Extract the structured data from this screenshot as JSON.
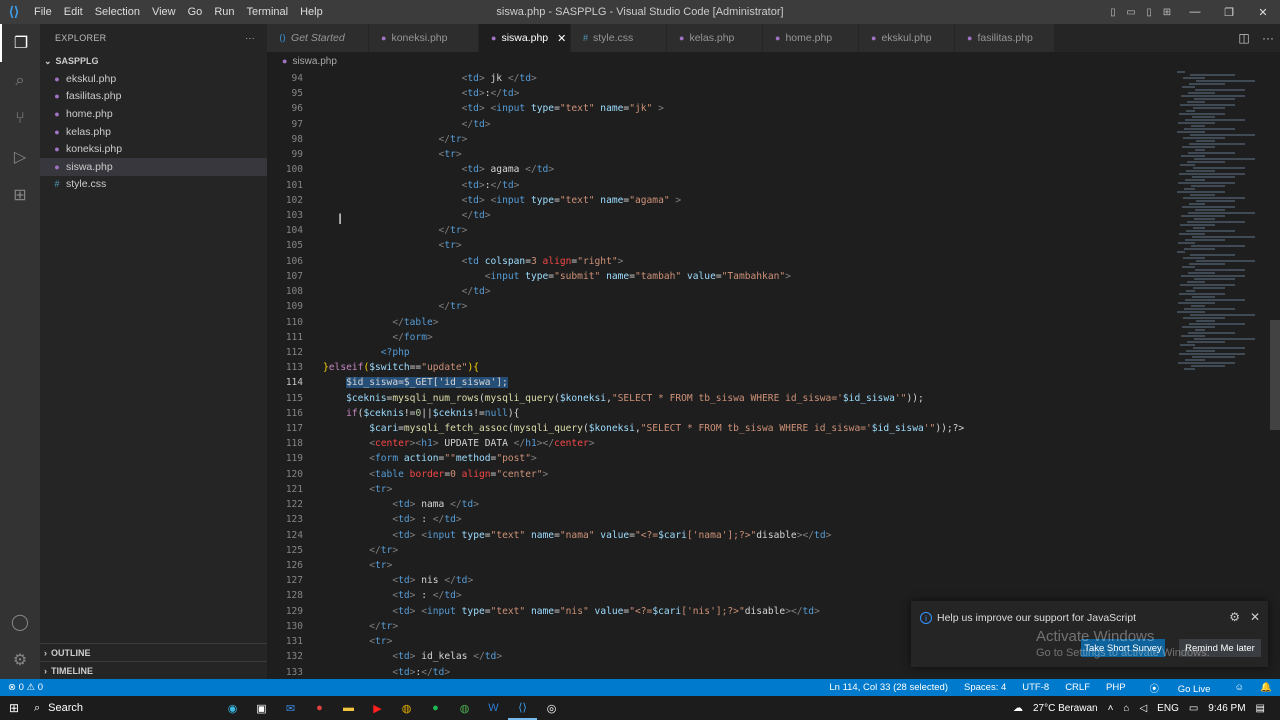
{
  "window": {
    "title": "siswa.php - SASPPLG - Visual Studio Code [Administrator]",
    "menu": [
      "File",
      "Edit",
      "Selection",
      "View",
      "Go",
      "Run",
      "Terminal",
      "Help"
    ]
  },
  "sidebar": {
    "header": "EXPLORER",
    "folder": "SASPPLG",
    "files": [
      {
        "name": "ekskul.php",
        "type": "php"
      },
      {
        "name": "fasilitas.php",
        "type": "php"
      },
      {
        "name": "home.php",
        "type": "php"
      },
      {
        "name": "kelas.php",
        "type": "php"
      },
      {
        "name": "koneksi.php",
        "type": "php"
      },
      {
        "name": "siswa.php",
        "type": "php"
      },
      {
        "name": "style.css",
        "type": "css"
      }
    ],
    "outline": "OUTLINE",
    "timeline": "TIMELINE"
  },
  "tabs": [
    {
      "label": "Get Started",
      "icon": "vscode-icon"
    },
    {
      "label": "koneksi.php",
      "icon": "php-icon"
    },
    {
      "label": "siswa.php",
      "icon": "php-icon",
      "active": true
    },
    {
      "label": "style.css",
      "icon": "css-icon"
    },
    {
      "label": "kelas.php",
      "icon": "php-icon"
    },
    {
      "label": "home.php",
      "icon": "php-icon"
    },
    {
      "label": "ekskul.php",
      "icon": "php-icon"
    },
    {
      "label": "fasilitas.php",
      "icon": "php-icon"
    }
  ],
  "breadcrumb": "siswa.php",
  "editor": {
    "line_numbers": [
      "94",
      "95",
      "96",
      "97",
      "98",
      "99",
      "100",
      "101",
      "102",
      "103",
      "104",
      "105",
      "106",
      "107",
      "108",
      "109",
      "110",
      "111",
      "112",
      "113",
      "114",
      "115",
      "116",
      "117",
      "118",
      "119",
      "120",
      "121",
      "122",
      "123",
      "124",
      "125",
      "126",
      "127",
      "128",
      "129",
      "130",
      "131",
      "132",
      "133"
    ],
    "current_line": "114"
  },
  "notification": {
    "message": "Help us improve our support for JavaScript",
    "primary": "Take Short Survey",
    "secondary": "Remind Me later"
  },
  "watermark": {
    "line1": "Activate Windows",
    "line2": "Go to Settings to activate Windows."
  },
  "statusbar": {
    "problems": "0",
    "warnings": "0",
    "position": "Ln 114, Col 33 (28 selected)",
    "spaces": "Spaces: 4",
    "encoding": "UTF-8",
    "eol": "CRLF",
    "language": "PHP",
    "golive": "Go Live"
  },
  "taskbar": {
    "search": "Search",
    "weather": "27°C  Berawan",
    "lang": "ENG",
    "time": "9:46 PM"
  }
}
